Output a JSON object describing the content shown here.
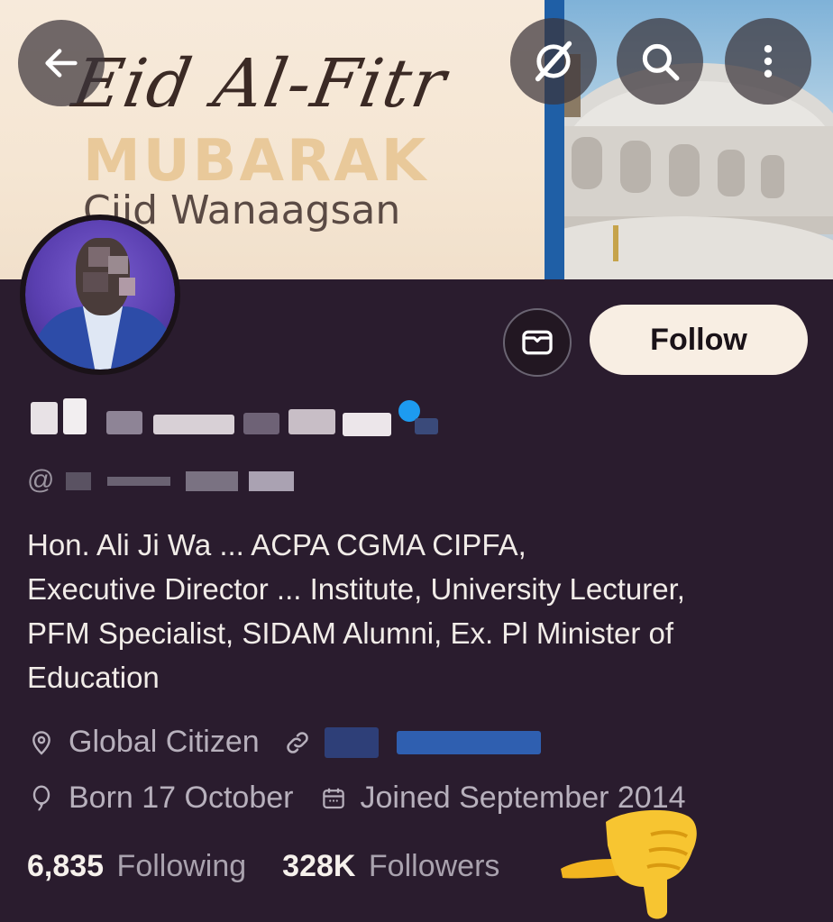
{
  "banner": {
    "script_title": "Eid Al-Fitr",
    "headline": "MUBARAK",
    "greeting": "Ciid Wanaagsan"
  },
  "top_bar": {
    "back_icon": "arrow-left-icon",
    "grok_icon": "grok-icon",
    "search_icon": "search-icon",
    "more_icon": "more-vertical-icon"
  },
  "actions": {
    "message_icon": "envelope-icon",
    "follow_label": "Follow"
  },
  "profile": {
    "handle_prefix": "@",
    "bio_lines": [
      "Hon. Ali Ji Wa ... ACPA CGMA CIPFA,",
      "Executive Director ... Institute, University Lecturer,",
      "PFM Specialist, SIDAM Alumni, Ex. Pl Minister of",
      "Education"
    ],
    "location": "Global Citizen",
    "birthday": "Born 17 October",
    "joined": "Joined September 2014"
  },
  "stats": {
    "following_count": "6,835",
    "following_label": "Following",
    "followers_count": "328K",
    "followers_label": "Followers"
  },
  "colors": {
    "background": "#2a1c2e",
    "follow_button": "#f8eee3",
    "muted_text": "#b7b0bc",
    "verified_badge": "#1d9bf0",
    "link_blurred": "#2f5fb0"
  }
}
